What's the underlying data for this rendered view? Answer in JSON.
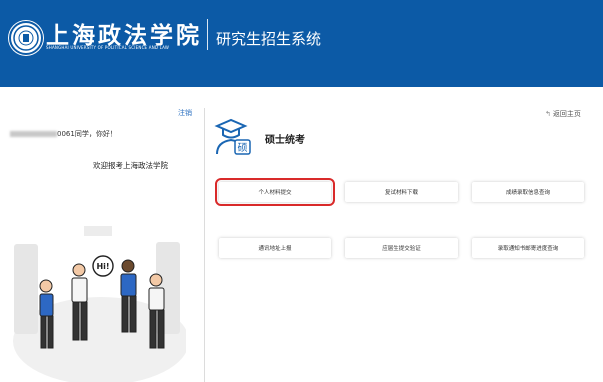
{
  "header": {
    "school_name_cn": "上海政法学院",
    "school_name_en": "SHANGHAI UNIVERSITY OF POLITICAL SCIENCE AND LAW",
    "system_title": "研究生招生系统",
    "brand_color": "#0c5aa6"
  },
  "sidebar": {
    "logout_label": "注销",
    "greeting_suffix": "0061同学，你好！",
    "welcome_text": "欢迎报考上海政法学院"
  },
  "main": {
    "back_home_label": "返回主页",
    "section_title": "硕士统考",
    "section_icon_glyph": "硕",
    "buttons": [
      {
        "label": "个人材料提交"
      },
      {
        "label": "复试材料下载"
      },
      {
        "label": "成绩录取信息查询"
      },
      {
        "label": "通讯地址上报"
      },
      {
        "label": "应届生提交验证"
      },
      {
        "label": "录取通知书邮寄进度查询"
      }
    ],
    "highlight_color": "#d92a2a"
  },
  "illustration": {
    "speech_bubble": "Hi!"
  }
}
